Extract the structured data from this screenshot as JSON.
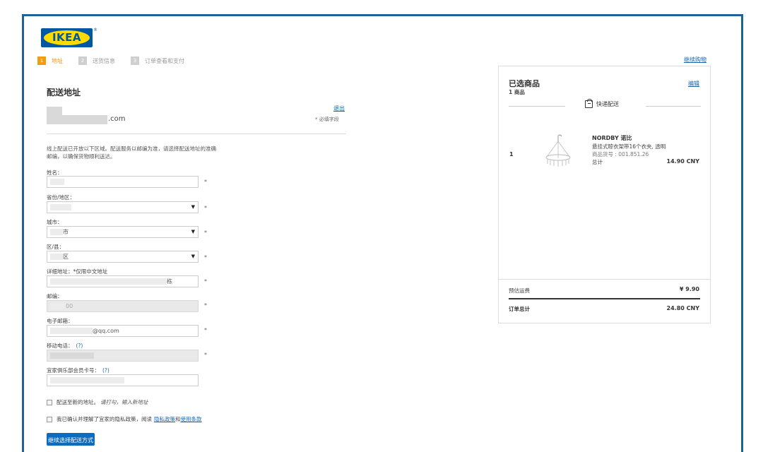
{
  "brand": {
    "logo_text": "IKEA",
    "reg_mark": "®",
    "color": "#0058a3",
    "accent": "#ffdb00"
  },
  "steps": [
    {
      "num": "1",
      "label": "地址",
      "active": true
    },
    {
      "num": "2",
      "label": "送货信息",
      "active": false
    },
    {
      "num": "3",
      "label": "订单查看和支付",
      "active": false
    }
  ],
  "continue_shopping": "继续购物",
  "shipping": {
    "title": "配送地址",
    "account_email_suffix": ".com",
    "logout": "退出",
    "required_note": "* 必填字段",
    "notice": "线上配送已开放以下区域。配送服务以邮编为准，请选择配送地址的准确邮编，以确保货物顺利送达。"
  },
  "form": {
    "name_label": "姓名：",
    "province_label": "省份/地区：",
    "city_label": "城市：",
    "city_value": "市",
    "district_label": "区/县：",
    "district_value": "区",
    "address_label": "详细地址：*仅限中文地址",
    "address_value": "栋",
    "zip_label": "邮编：",
    "zip_value": "00",
    "email_label": "电子邮箱：",
    "email_value": "@qq.com",
    "phone_label": "移动电话：",
    "phone_help": "(?)",
    "member_label": "宜家俱乐部会员卡号：",
    "member_help": "(?)",
    "required_star": "*",
    "dropdown_caret": "▼",
    "new_address_label": "配送至新的地址。",
    "new_address_hint": "请打勾，输入新地址",
    "privacy_text": "我已确认并理解了宜家的隐私政策，阅读",
    "privacy_link": "隐私政策",
    "and_text": "和",
    "terms_link": "使用条款",
    "submit_label": "继续选择配送方式"
  },
  "cart": {
    "title": "已选商品",
    "count": "1 商品",
    "edit": "编辑",
    "shipping_method": "快递配送",
    "item": {
      "qty": "1",
      "name": "NORDBY 诺比",
      "desc": "悬挂式晾衣架带16个衣夹, 透明",
      "sku": "商品货号 : 001.851.26",
      "total_label": "总计",
      "total_value": "14.90 CNY"
    },
    "ship_fee_label": "预估运费",
    "ship_fee_value": "¥ 9.90",
    "order_total_label": "订单总计",
    "order_total_value": "24.80 CNY"
  }
}
